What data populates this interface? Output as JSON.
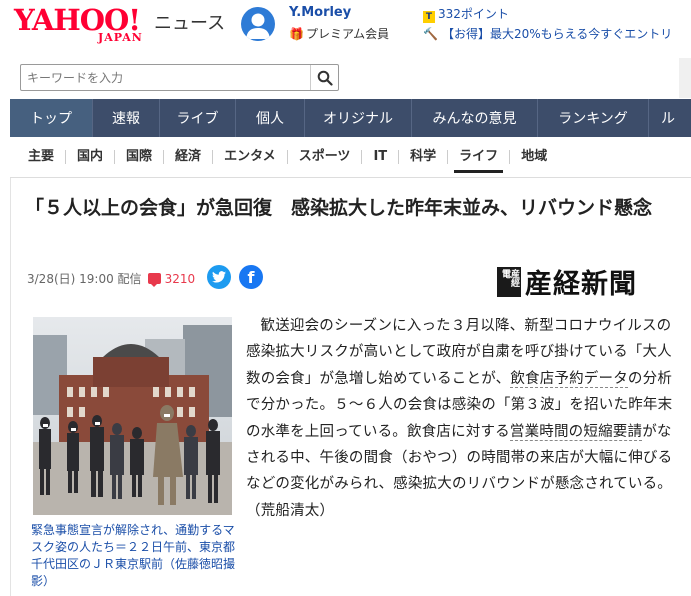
{
  "header": {
    "logo_text": "YAHOO!",
    "logo_subtext": "JAPAN",
    "service_name": "ニュース",
    "user": {
      "name": "Y.Morley",
      "membership": "プレミアム会員",
      "gift_icon": "gift-icon"
    },
    "points": "332ポイント",
    "promo": "【お得】最大20%もらえる今すぐエントリ"
  },
  "search": {
    "placeholder": "キーワードを入力",
    "icon": "search-icon"
  },
  "main_nav": [
    {
      "label": "トップ",
      "active": true
    },
    {
      "label": "速報"
    },
    {
      "label": "ライブ"
    },
    {
      "label": "個人"
    },
    {
      "label": "オリジナル"
    },
    {
      "label": "みんなの意見"
    },
    {
      "label": "ランキング"
    },
    {
      "label": "ル"
    }
  ],
  "sub_nav": [
    {
      "label": "主要"
    },
    {
      "label": "国内"
    },
    {
      "label": "国際"
    },
    {
      "label": "経済"
    },
    {
      "label": "エンタメ"
    },
    {
      "label": "スポーツ"
    },
    {
      "label": "IT"
    },
    {
      "label": "科学"
    },
    {
      "label": "ライフ",
      "active": true
    },
    {
      "label": "地域"
    }
  ],
  "article": {
    "headline": "「５人以上の会食」が急回復　感染拡大した昨年末並み、リバウンド懸念",
    "date": "3/28(日) 19:00",
    "distributed": "配信",
    "comment_count": "3210",
    "publisher": "産経新聞",
    "publisher_seal": "産經電",
    "photo_caption": "緊急事態宣言が解除され、通勤するマスク姿の人たち＝２２日午前、東京都千代田区のＪＲ東京駅前（佐藤徳昭撮影）",
    "body": {
      "p1": "歓送迎会のシーズンに入った３月以降、新型コロナウイルスの感染拡大リスクが高いとして政府が自粛を呼び掛けている「大人数の会食」が急増し始めていることが、",
      "kw1": "飲食店予約データ",
      "p2": "の分析で分かった。５～６人の会食は感染の「第３波」を招いた昨年末の水準を上回っている。飲食店に対する",
      "kw2": "営業時間の短縮要請",
      "p3": "がなされる中、午後の間食（おやつ）の時間帯の来店が大幅に伸びるなどの変化がみられ、感染拡大のリバウンドが懸念されている。（荒船清太）"
    }
  },
  "colors": {
    "brand_red": "#ff0033",
    "nav_bg": "#3d4d6a",
    "link_blue": "#1a4ea8",
    "comment_red": "#e8394c"
  }
}
